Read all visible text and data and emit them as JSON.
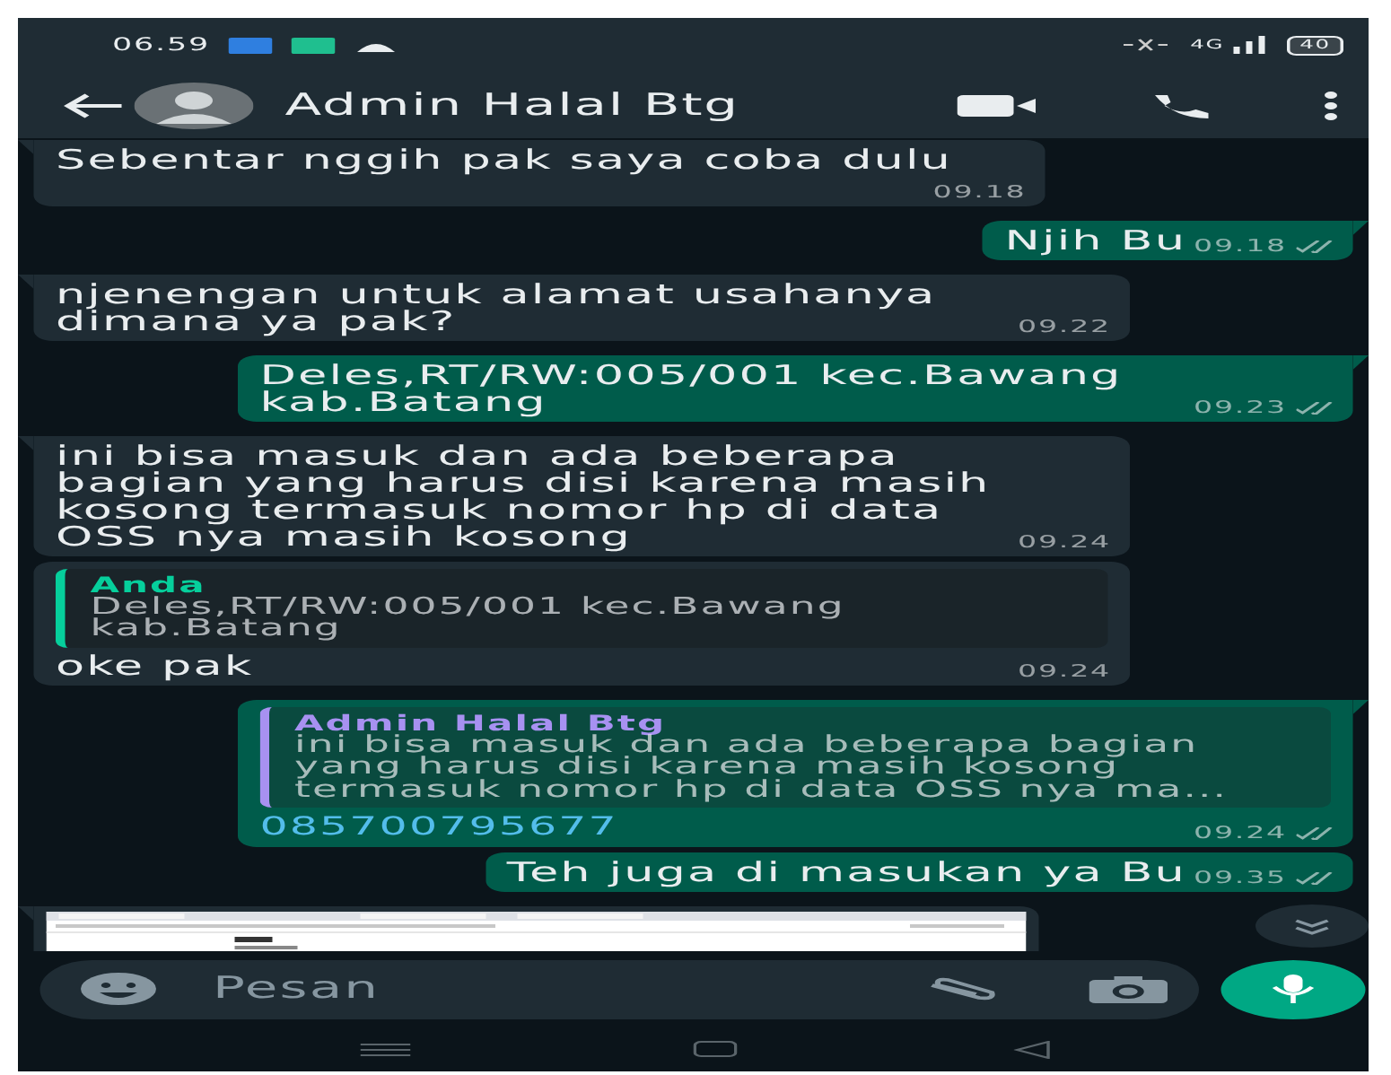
{
  "status_bar": {
    "time": "06.59",
    "network": "4G",
    "battery": "40"
  },
  "header": {
    "title": "Admin Halal Btg"
  },
  "messages": [
    {
      "kind": "text",
      "outgoing": false,
      "tail": true,
      "text": "Sebentar nggih pak saya coba dulu",
      "time": "09.18"
    },
    {
      "kind": "text",
      "outgoing": true,
      "tail": true,
      "text": "Njih Bu",
      "time": "09.18",
      "read": false
    },
    {
      "kind": "text",
      "outgoing": false,
      "tail": true,
      "text": "njenengan untuk alamat usahanya\ndimana ya pak?",
      "time": "09.22"
    },
    {
      "kind": "text",
      "outgoing": true,
      "tail": true,
      "text": "Deles,RT/RW:005/001 kec.Bawang\nkab.Batang",
      "time": "09.23",
      "read": false
    },
    {
      "kind": "text",
      "outgoing": false,
      "tail": true,
      "text": "ini bisa masuk dan ada beberapa\nbagian yang harus disi karena masih\nkosong termasuk nomor hp di data\nOSS nya masih kosong",
      "time": "09.24"
    },
    {
      "kind": "text",
      "outgoing": false,
      "tail": false,
      "quote": {
        "author": "Anda",
        "text": "Deles,RT/RW:005/001 kec.Bawang\nkab.Batang",
        "color": "#06cf9c"
      },
      "text": "oke pak",
      "time": "09.24"
    },
    {
      "kind": "text",
      "outgoing": true,
      "tail": true,
      "quote": {
        "author": "Admin Halal Btg",
        "text": "ini bisa masuk dan ada beberapa bagian\nyang harus disi karena masih kosong\ntermasuk nomor hp di data OSS nya ma...",
        "color": "#a791f1"
      },
      "text": "085700795677",
      "link": true,
      "time": "09.24",
      "read": false
    },
    {
      "kind": "text",
      "outgoing": true,
      "tail": false,
      "text": "Teh juga di masukan ya Bu",
      "time": "09.35",
      "read": false
    },
    {
      "kind": "image",
      "outgoing": false,
      "tail": true
    }
  ],
  "composer": {
    "placeholder": "Pesan"
  }
}
